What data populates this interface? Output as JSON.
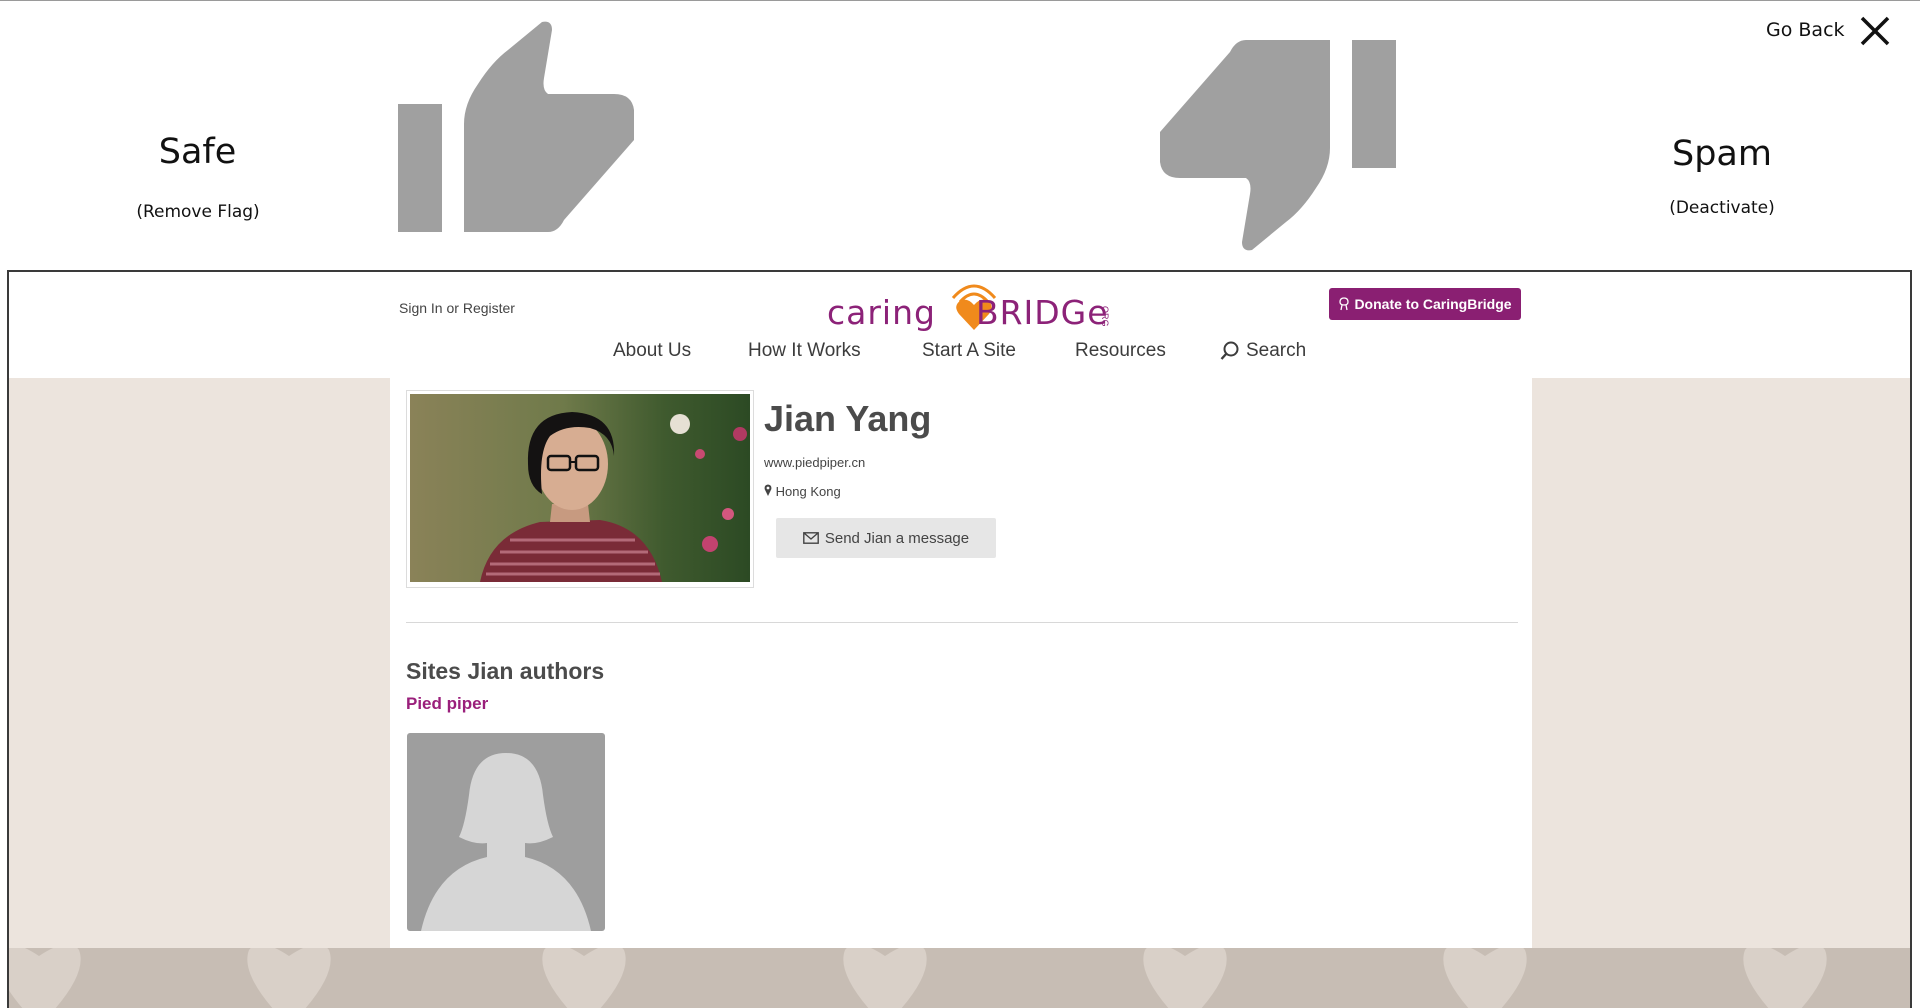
{
  "moderation": {
    "safe_title": "Safe",
    "safe_sub": "(Remove Flag)",
    "spam_title": "Spam",
    "spam_sub": "(Deactivate)",
    "go_back": "Go Back",
    "icons": [
      "thumbs-up-icon",
      "thumbs-down-icon",
      "close-icon"
    ]
  },
  "header": {
    "sign_in": "Sign In",
    "or": "or",
    "register": "Register",
    "logo_caring": "caring",
    "logo_bridge": "BRIDGe",
    "logo_org": "ORG",
    "donate_label": "Donate to CaringBridge",
    "nav": [
      "About Us",
      "How It Works",
      "Start A Site",
      "Resources",
      "Search"
    ]
  },
  "profile": {
    "name": "Jian Yang",
    "website": "www.piedpiper.cn",
    "location": "Hong Kong",
    "message_button": "Send Jian a message"
  },
  "sites": {
    "heading": "Sites Jian authors",
    "items": [
      {
        "title": "Pied piper"
      }
    ]
  },
  "colors": {
    "brand_purple": "#8a1f72",
    "heart_orange": "#f08a1c",
    "icon_gray": "#a0a0a0",
    "page_bg": "#ece4dd",
    "footer_band": "#c7bdb4"
  }
}
